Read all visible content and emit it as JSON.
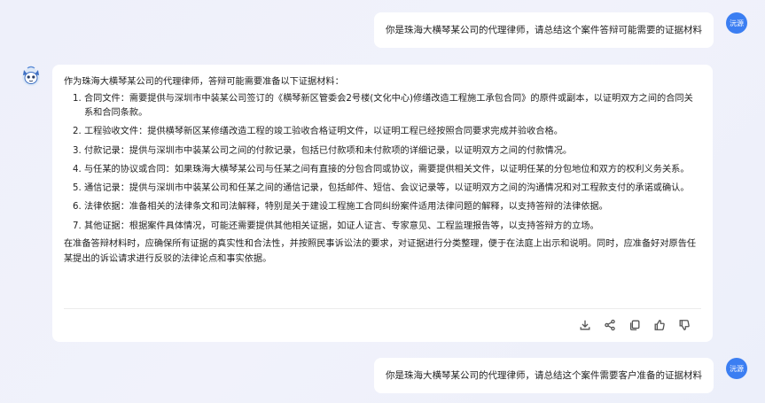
{
  "user": {
    "avatar_label": "沅源",
    "messages": [
      "你是珠海大横琴某公司的代理律师，请总结这个案件答辩可能需要的证据材料",
      "你是珠海大横琴某公司的代理律师，请总结这个案件需要客户准备的证据材料"
    ]
  },
  "bot": {
    "intro": "作为珠海大横琴某公司的代理律师，答辩可能需要准备以下证据材料：",
    "items": [
      {
        "num": "1.",
        "text": "合同文件：需要提供与深圳市中装某公司签订的《横琴新区管委会2号楼(文化中心)修缮改造工程施工承包合同》的原件或副本，以证明双方之间的合同关系和合同条款。"
      },
      {
        "num": "2.",
        "text": "工程验收文件：提供横琴新区某修缮改造工程的竣工验收合格证明文件，以证明工程已经按照合同要求完成并验收合格。"
      },
      {
        "num": "3.",
        "text": "付款记录：提供与深圳市中装某公司之间的付款记录，包括已付款项和未付款项的详细记录，以证明双方之间的付款情况。"
      },
      {
        "num": "4.",
        "text": "与任某的协议或合同：如果珠海大横琴某公司与任某之间有直接的分包合同或协议，需要提供相关文件，以证明任某的分包地位和双方的权利义务关系。"
      },
      {
        "num": "5.",
        "text": "通信记录：提供与深圳市中装某公司和任某之间的通信记录，包括邮件、短信、会议记录等，以证明双方之间的沟通情况和对工程款支付的承诺或确认。"
      },
      {
        "num": "6.",
        "text": "法律依据：准备相关的法律条文和司法解释，特别是关于建设工程施工合同纠纷案件适用法律问题的解释，以支持答辩的法律依据。"
      },
      {
        "num": "7.",
        "text": "其他证据：根据案件具体情况，可能还需要提供其他相关证据，如证人证言、专家意见、工程监理报告等，以支持答辩方的立场。"
      }
    ],
    "conclusion": "在准备答辩材料时，应确保所有证据的真实性和合法性，并按照民事诉讼法的要求，对证据进行分类整理，便于在法庭上出示和说明。同时，应准备好对原告任某提出的诉讼请求进行反驳的法律论点和事实依据。",
    "actions": [
      "download-icon",
      "share-icon",
      "copy-icon",
      "thumbs-up-icon",
      "thumbs-down-icon"
    ]
  }
}
